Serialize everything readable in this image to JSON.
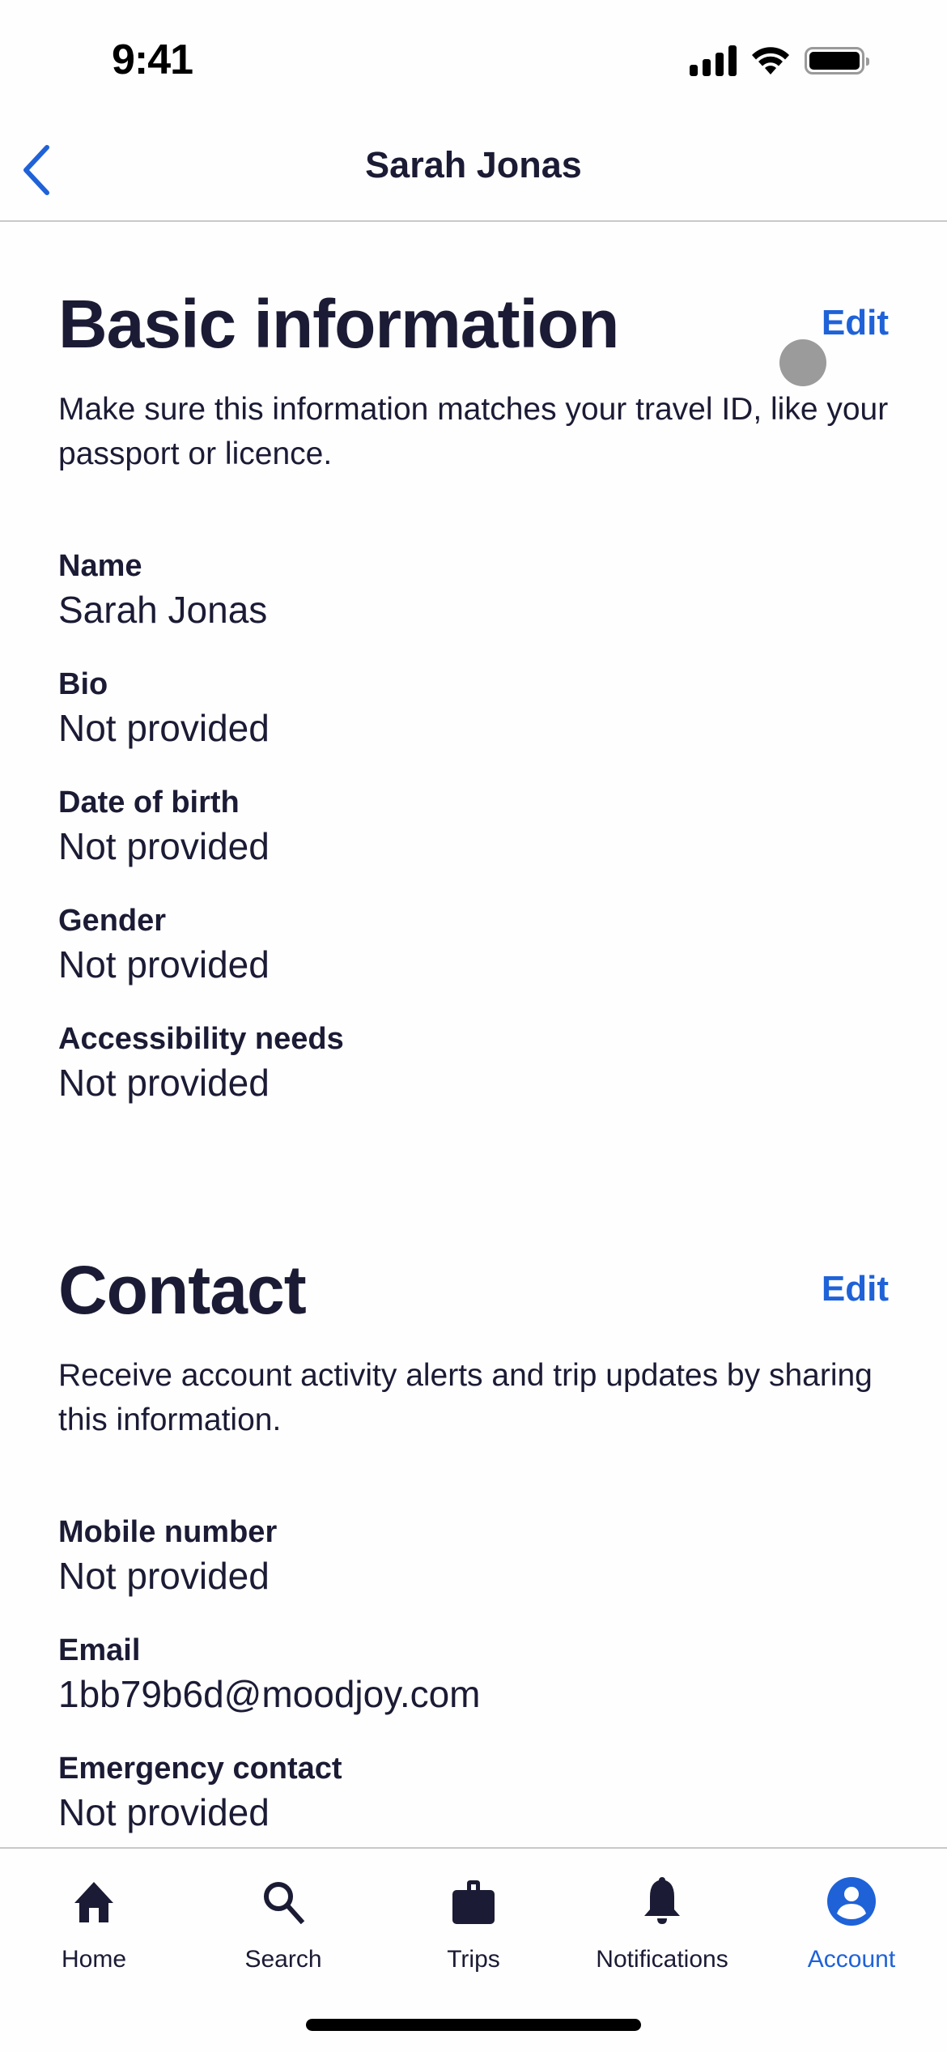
{
  "status_bar": {
    "time": "9:41"
  },
  "nav": {
    "title": "Sarah Jonas",
    "back_icon": "chevron-left-icon"
  },
  "colors": {
    "accent": "#1f62d8",
    "text": "#1b1b35",
    "separator": "#c9c9c9",
    "touch": "#9b9b9b"
  },
  "basic_info": {
    "title": "Basic information",
    "edit_label": "Edit",
    "description": "Make sure this information matches your travel ID, like your passport or licence.",
    "fields": [
      {
        "label": "Name",
        "value": "Sarah Jonas"
      },
      {
        "label": "Bio",
        "value": "Not provided"
      },
      {
        "label": "Date of birth",
        "value": "Not provided"
      },
      {
        "label": "Gender",
        "value": "Not provided"
      },
      {
        "label": "Accessibility needs",
        "value": "Not provided"
      }
    ]
  },
  "contact": {
    "title": "Contact",
    "edit_label": "Edit",
    "description": "Receive account activity alerts and trip updates by sharing this information.",
    "fields": [
      {
        "label": "Mobile number",
        "value": "Not provided"
      },
      {
        "label": "Email",
        "value": "1bb79b6d@moodjoy.com"
      },
      {
        "label": "Emergency contact",
        "value": "Not provided"
      }
    ]
  },
  "tab_bar": {
    "tabs": [
      {
        "label": "Home",
        "icon": "home-icon",
        "active": false
      },
      {
        "label": "Search",
        "icon": "search-icon",
        "active": false
      },
      {
        "label": "Trips",
        "icon": "briefcase-icon",
        "active": false
      },
      {
        "label": "Notifications",
        "icon": "bell-icon",
        "active": false
      },
      {
        "label": "Account",
        "icon": "account-icon",
        "active": true
      }
    ]
  }
}
